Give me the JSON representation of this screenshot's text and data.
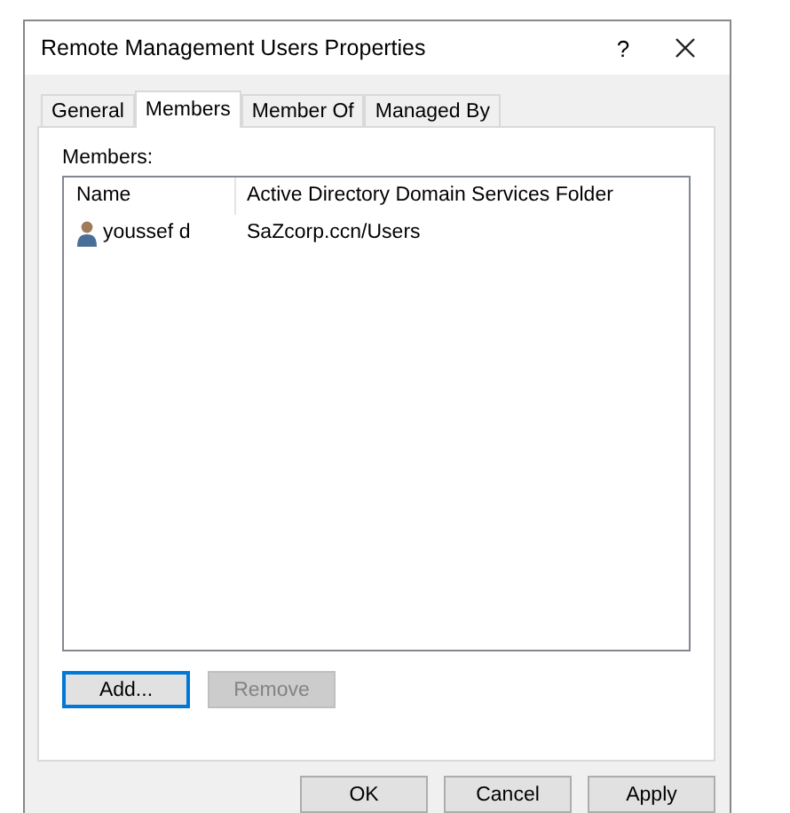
{
  "window": {
    "title": "Remote Management Users Properties",
    "help": "?"
  },
  "tabs": [
    {
      "label": "General",
      "selected": false
    },
    {
      "label": "Members",
      "selected": true
    },
    {
      "label": "Member Of",
      "selected": false
    },
    {
      "label": "Managed By",
      "selected": false
    }
  ],
  "members_label": "Members:",
  "list": {
    "columns": [
      "Name",
      "Active Directory Domain Services Folder"
    ],
    "rows": [
      {
        "name": "youssef d",
        "folder": "SaZcorp.ccn/Users"
      }
    ]
  },
  "list_buttons": [
    {
      "label": "Add...",
      "disabled": false,
      "focused": true
    },
    {
      "label": "Remove",
      "disabled": true,
      "focused": false
    }
  ],
  "dialog_buttons": [
    "OK",
    "Cancel",
    "Apply"
  ]
}
